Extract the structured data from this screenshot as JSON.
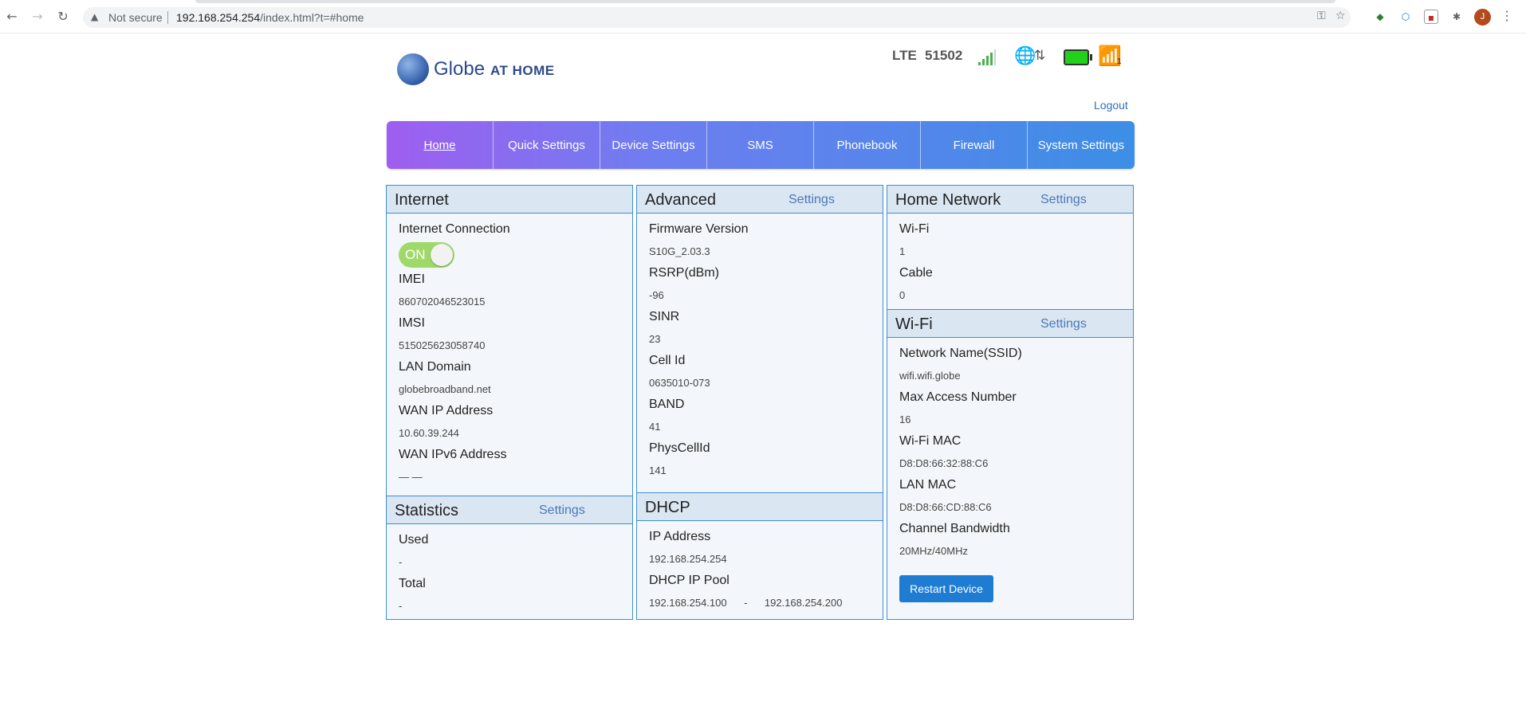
{
  "browser": {
    "security_label": "Not secure",
    "url_host": "192.168.254.254",
    "url_path": "/index.html?t=#home",
    "avatar_initial": "J"
  },
  "header": {
    "brand": "Globe",
    "brand_sub": "AT HOME",
    "network_type": "LTE",
    "network_code": "51502",
    "signal_bars": 4,
    "signal_max": 5,
    "wifi_clients": "1",
    "logout_label": "Logout"
  },
  "nav": {
    "tabs": [
      {
        "label": "Home",
        "active": true
      },
      {
        "label": "Quick Settings"
      },
      {
        "label": "Device Settings"
      },
      {
        "label": "SMS"
      },
      {
        "label": "Phonebook"
      },
      {
        "label": "Firewall"
      },
      {
        "label": "System Settings"
      }
    ]
  },
  "internet": {
    "title": "Internet",
    "connection_label": "Internet Connection",
    "connection_state": "ON",
    "fields": [
      {
        "label": "IMEI",
        "value": "860702046523015"
      },
      {
        "label": "IMSI",
        "value": "515025623058740"
      },
      {
        "label": "LAN Domain",
        "value": "globebroadband.net"
      },
      {
        "label": "WAN IP Address",
        "value": "10.60.39.244"
      },
      {
        "label": "WAN IPv6 Address",
        "value": "— —"
      }
    ]
  },
  "statistics": {
    "title": "Statistics",
    "settings_label": "Settings",
    "fields": [
      {
        "label": "Used",
        "value": "-"
      },
      {
        "label": "Total",
        "value": "-"
      }
    ]
  },
  "advanced": {
    "title": "Advanced",
    "settings_label": "Settings",
    "fields": [
      {
        "label": "Firmware Version",
        "value": "S10G_2.03.3"
      },
      {
        "label": "RSRP(dBm)",
        "value": "-96"
      },
      {
        "label": "SINR",
        "value": "23"
      },
      {
        "label": "Cell Id",
        "value": "0635010-073"
      },
      {
        "label": "BAND",
        "value": "41"
      },
      {
        "label": "PhysCellId",
        "value": "141"
      }
    ]
  },
  "dhcp": {
    "title": "DHCP",
    "ip_label": "IP Address",
    "ip_value": "192.168.254.254",
    "pool_label": "DHCP IP Pool",
    "pool_start": "192.168.254.100",
    "pool_sep": "-",
    "pool_end": "192.168.254.200"
  },
  "home_network": {
    "title": "Home Network",
    "settings_label": "Settings",
    "fields": [
      {
        "label": "Wi-Fi",
        "value": "1"
      },
      {
        "label": "Cable",
        "value": "0"
      }
    ]
  },
  "wifi": {
    "title": "Wi-Fi",
    "settings_label": "Settings",
    "fields": [
      {
        "label": "Network Name(SSID)",
        "value": "wifi.wifi.globe"
      },
      {
        "label": "Max Access Number",
        "value": "16"
      },
      {
        "label": "Wi-Fi MAC",
        "value": "D8:D8:66:32:88:C6"
      },
      {
        "label": "LAN MAC",
        "value": "D8:D8:66:CD:88:C6"
      },
      {
        "label": "Channel Bandwidth",
        "value": "20MHz/40MHz"
      }
    ],
    "restart_label": "Restart Device"
  }
}
